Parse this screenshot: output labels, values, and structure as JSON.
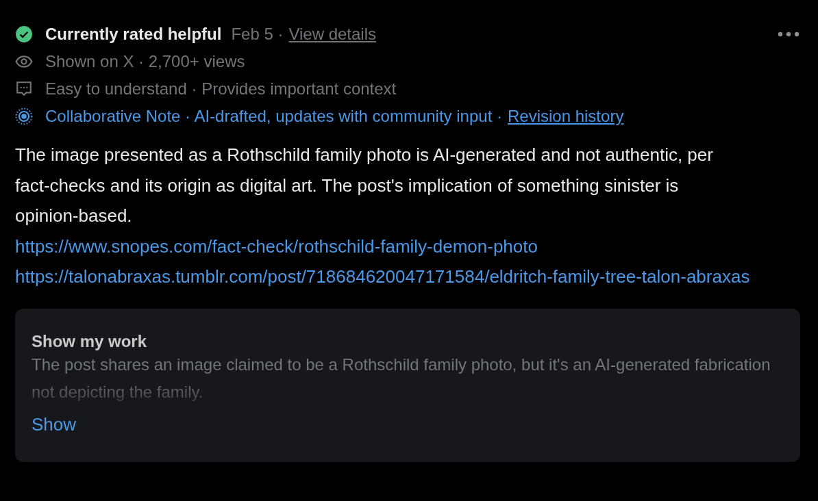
{
  "status": {
    "rated_helpful": true,
    "label": "Currently rated helpful",
    "date": "Feb 5 ·",
    "link": "View details"
  },
  "meta": [
    {
      "kind": "views",
      "text": "Shown on X · 2,700+ views"
    },
    {
      "kind": "ratings",
      "text": "Easy to understand · Provides important context"
    }
  ],
  "collab": {
    "text": "Collaborative Note · AI-drafted, updates with community input ·",
    "link": "Revision history"
  },
  "body": {
    "text": "The image presented as a Rothschild family photo is AI-generated and not authentic, per fact-checks and its origin as digital art. The post's implication of something sinister is opinion-based.",
    "links": [
      "https://www.snopes.com/fact-check/rothschild-family-demon-photo",
      "https://talonabraxas.tumblr.com/post/718684620047171584/eldritch-family-tree-talon-abraxas"
    ]
  },
  "work": {
    "title": "Show my work",
    "text": "The post shares an image claimed to be a Rothschild family photo, but it's an AI-generated fabrication not depicting the family.",
    "button": "Show"
  }
}
